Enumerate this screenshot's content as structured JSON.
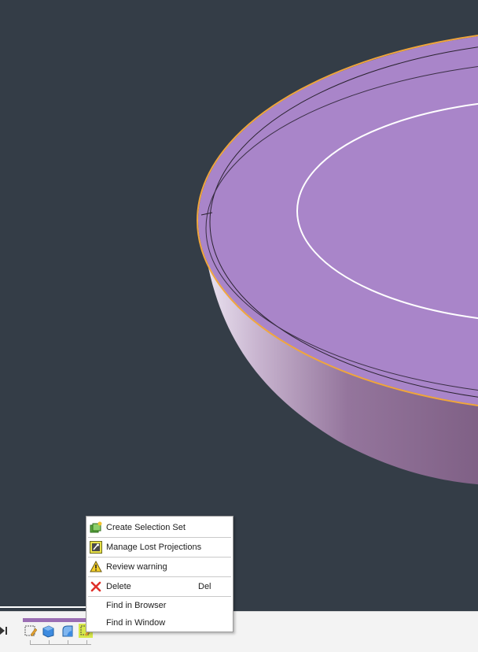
{
  "theme": {
    "canvas_background": "#343d47",
    "model_face_color": "#a985c9",
    "model_side_color": "#8a6b90",
    "selection_highlight": "#f0a63c",
    "menu_background": "#ffffff"
  },
  "context_menu": {
    "items": [
      {
        "label": "Create Selection Set",
        "icon": "selection-set-icon",
        "shortcut": ""
      },
      {
        "label": "Manage Lost Projections",
        "icon": "lost-projections-icon",
        "shortcut": ""
      },
      {
        "label": "Review warning",
        "icon": "warning-icon",
        "shortcut": ""
      },
      {
        "label": "Delete",
        "icon": "delete-x-icon",
        "shortcut": "Del"
      },
      {
        "label": "Find in Browser",
        "icon": "",
        "shortcut": ""
      },
      {
        "label": "Find in Window",
        "icon": "",
        "shortcut": ""
      }
    ]
  },
  "timeline": {
    "icons": [
      "play-to-end-icon",
      "sketch-icon",
      "extrude-icon",
      "fillet-icon",
      "selected-feature-icon"
    ]
  }
}
